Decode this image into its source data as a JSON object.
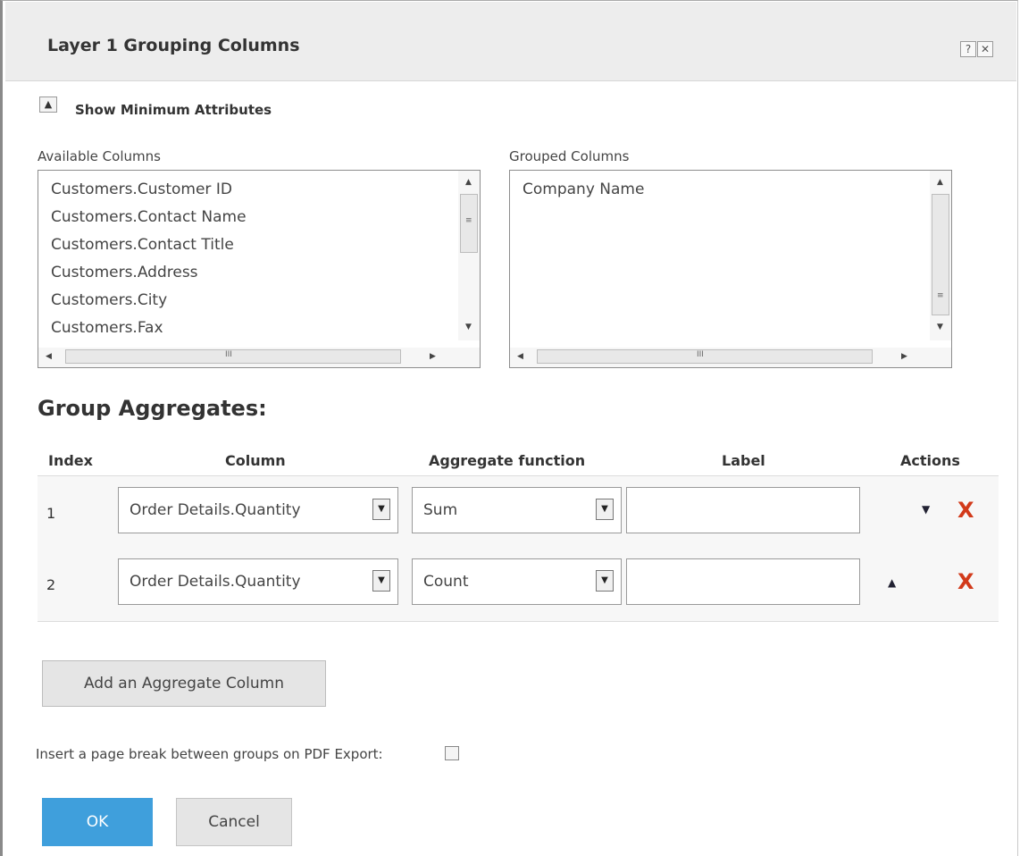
{
  "dialog": {
    "title": "Layer 1 Grouping Columns",
    "help_label": "?",
    "close_label": "✕"
  },
  "attributes_toggle": {
    "label": "Show Minimum Attributes"
  },
  "available_columns": {
    "label": "Available Columns",
    "items": [
      "Customers.Customer ID",
      "Customers.Contact Name",
      "Customers.Contact Title",
      "Customers.Address",
      "Customers.City",
      "Customers.Fax"
    ]
  },
  "grouped_columns": {
    "label": "Grouped Columns",
    "items": [
      "Company Name"
    ]
  },
  "group_aggregates": {
    "title": "Group Aggregates:",
    "headers": {
      "index": "Index",
      "column": "Column",
      "aggregate_function": "Aggregate function",
      "label": "Label",
      "actions": "Actions"
    },
    "rows": [
      {
        "index": "1",
        "column": "Order Details.Quantity",
        "function": "Sum",
        "label": ""
      },
      {
        "index": "2",
        "column": "Order Details.Quantity",
        "function": "Count",
        "label": ""
      }
    ]
  },
  "add_button": "Add an Aggregate Column",
  "page_break": {
    "label": "Insert a page break between groups on PDF Export:",
    "checked": false
  },
  "ok_button": "OK",
  "cancel_button": "Cancel",
  "colors": {
    "ok_button": "#3f9fdc",
    "delete_icon": "#d23a1a",
    "titlebar": "#ededed"
  }
}
